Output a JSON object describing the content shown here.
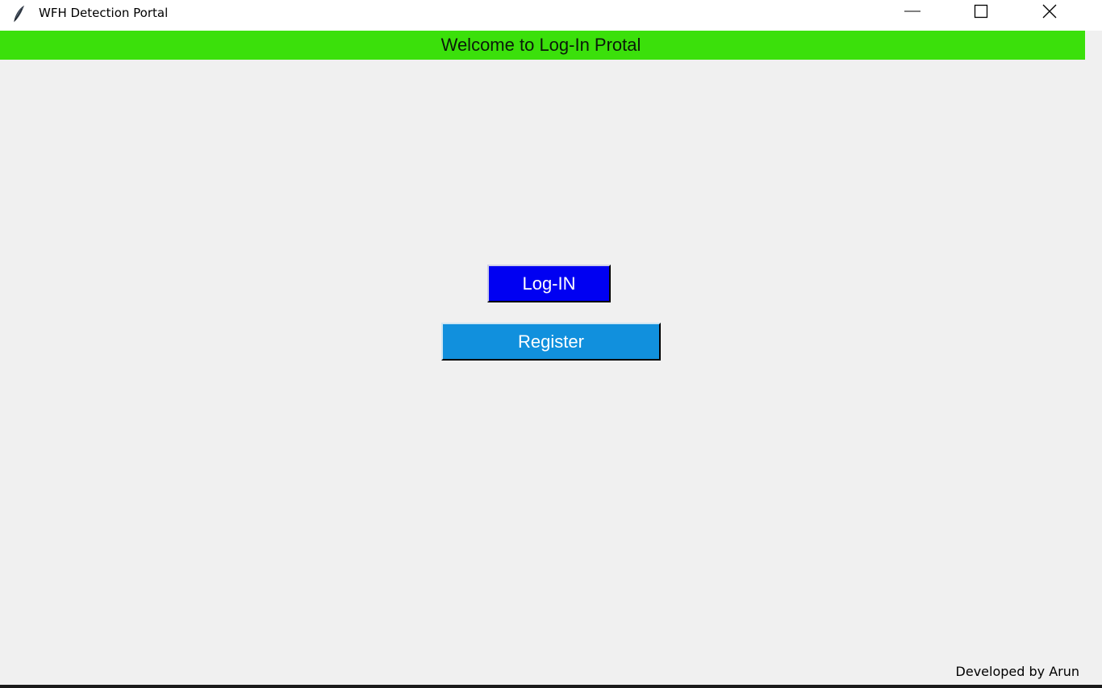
{
  "window": {
    "title": "WFH Detection Portal",
    "app_icon": "feather-icon",
    "controls": {
      "minimize_icon": "minimize-icon",
      "maximize_icon": "maximize-icon",
      "close_icon": "close-icon"
    }
  },
  "banner": {
    "text": "Welcome to Log-In Protal",
    "color": "#3be00b"
  },
  "buttons": {
    "login_label": "Log-IN",
    "login_color": "#0000f2",
    "register_label": "Register",
    "register_color": "#1190dd"
  },
  "footer": {
    "credit": "Developed by Arun"
  }
}
